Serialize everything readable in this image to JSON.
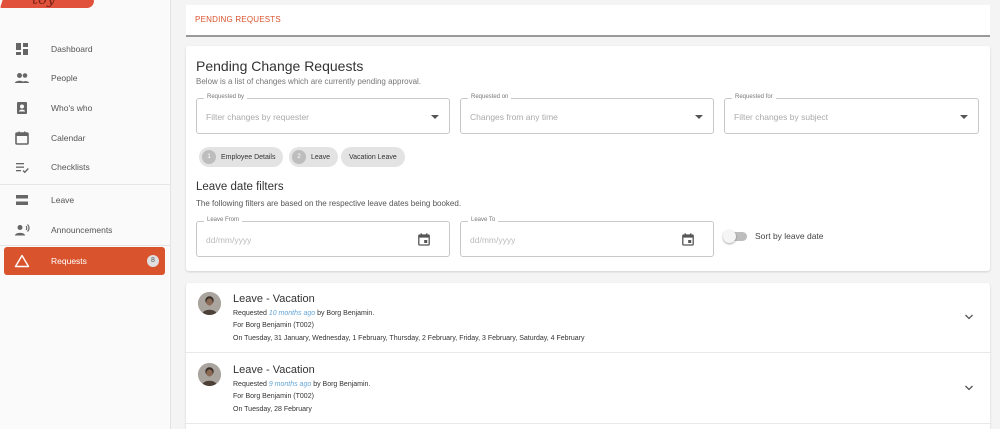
{
  "logo_text": "toy",
  "sidebar": {
    "items": [
      {
        "label": "Dashboard",
        "icon": "dashboard-icon"
      },
      {
        "label": "People",
        "icon": "people-icon"
      },
      {
        "label": "Who's who",
        "icon": "contact-card-icon"
      },
      {
        "label": "Calendar",
        "icon": "calendar-icon"
      },
      {
        "label": "Checklists",
        "icon": "checklist-icon"
      },
      {
        "label": "Leave",
        "icon": "leave-icon"
      },
      {
        "label": "Announcements",
        "icon": "announce-icon"
      },
      {
        "label": "Requests",
        "icon": "warning-triangle-icon",
        "badge": "8",
        "active": true
      }
    ]
  },
  "tabs": [
    {
      "label": "PENDING REQUESTS",
      "active": true
    }
  ],
  "filters": {
    "title": "Pending Change Requests",
    "subtitle": "Below is a list of changes which are currently pending approval.",
    "requested_by": {
      "label": "Requested by",
      "placeholder": "Filter changes by requester"
    },
    "requested_on": {
      "label": "Requested on",
      "placeholder": "Changes from any time"
    },
    "requested_for": {
      "label": "Requested for",
      "placeholder": "Filter changes by subject"
    },
    "chips": [
      {
        "count": "1",
        "label": "Employee Details"
      },
      {
        "count": "2",
        "label": "Leave"
      },
      {
        "count": "",
        "label": "Vacation Leave"
      }
    ],
    "leave_title": "Leave date filters",
    "leave_subtitle": "The following filters are based on the respective leave dates being booked.",
    "leave_from": {
      "label": "Leave From",
      "placeholder": "dd/mm/yyyy"
    },
    "leave_to": {
      "label": "Leave To",
      "placeholder": "dd/mm/yyyy"
    },
    "sort_label": "Sort by leave date",
    "sort_enabled": false
  },
  "requests": [
    {
      "title": "Leave - Vacation",
      "requested_prefix": "Requested",
      "ago": "10 months ago",
      "requested_suffix": "by Borg Benjamin.",
      "for": "For Borg Benjamin (T002)",
      "dates": "On Tuesday, 31 January, Wednesday, 1 February, Thursday, 2 February, Friday, 3 February, Saturday, 4 February"
    },
    {
      "title": "Leave - Vacation",
      "requested_prefix": "Requested",
      "ago": "9 months ago",
      "requested_suffix": "by Borg Benjamin.",
      "for": "For Borg Benjamin (T002)",
      "dates": "On Tuesday, 28 February"
    }
  ],
  "colors": {
    "accent": "#d9532d",
    "link": "#64a6d6"
  }
}
